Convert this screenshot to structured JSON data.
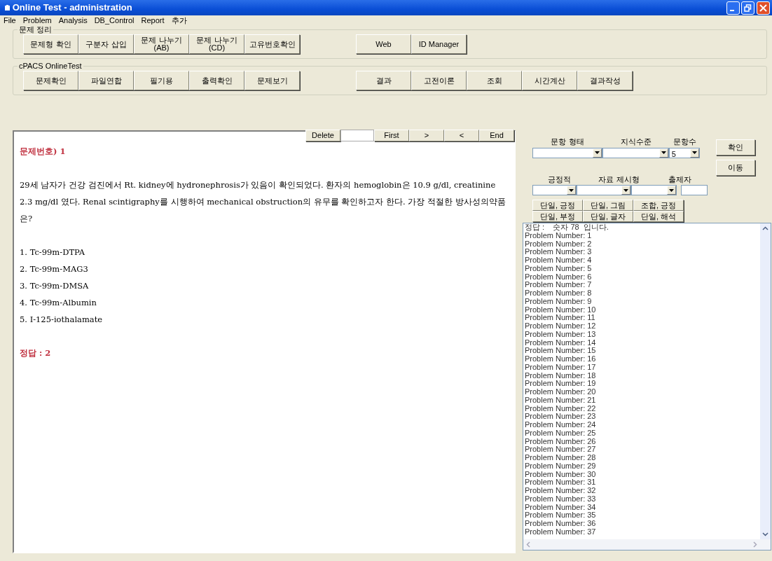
{
  "window": {
    "title": "Online Test - administration"
  },
  "menu": [
    "File",
    "Problem",
    "Analysis",
    "DB_Control",
    "Report",
    "추가"
  ],
  "groups": [
    {
      "label": "문제 정리",
      "left_buttons": [
        {
          "label": "문제형 확인"
        },
        {
          "label": "구분자 삽입"
        },
        {
          "label": "문제 나누기",
          "sublabel": "(AB)"
        },
        {
          "label": "문제 나누기",
          "sublabel": "(CD)"
        },
        {
          "label": "고유번호확인"
        }
      ],
      "right_buttons": [
        {
          "label": "Web"
        },
        {
          "label": "ID Manager"
        }
      ]
    },
    {
      "label": "cPACS OnlineTest",
      "left_buttons": [
        {
          "label": "문제확인"
        },
        {
          "label": "파일연합"
        },
        {
          "label": "필기용"
        },
        {
          "label": "출력확인"
        },
        {
          "label": "문제보기"
        }
      ],
      "right_buttons": [
        {
          "label": "결과"
        },
        {
          "label": "고전이론"
        },
        {
          "label": "조회"
        },
        {
          "label": "시간계산"
        },
        {
          "label": "결과작성"
        }
      ]
    }
  ],
  "navigator": [
    {
      "kind": "button",
      "label": "Delete"
    },
    {
      "kind": "field"
    },
    {
      "kind": "button",
      "label": "First"
    },
    {
      "kind": "button",
      "label": ">"
    },
    {
      "kind": "button",
      "label": "<"
    },
    {
      "kind": "button",
      "label": "End"
    }
  ],
  "problem": {
    "number": "문제번호) 1",
    "question": "29세 남자가 건강 검진에서 Rt. kidney에 hydronephrosis가 있음이 확인되었다. 환자의 hemoglobin은 10.9 g/dl, creatinine 2.3 mg/dl 였다. Renal scintigraphy를 시행하여 mechanical obstruction의 유무를 확인하고자 한다. 가장 적절한 방사성의약품은?",
    "options": [
      "1. Tc-99m-DTPA",
      "2. Tc-99m-MAG3",
      "3. Tc-99m-DMSA",
      "4. Tc-99m-Albumin",
      "5. I-125-iothalamate"
    ],
    "answer": "정답 : 2"
  },
  "filters_row_1": [
    {
      "label": "문항 형태"
    },
    {
      "label": "지식수준"
    },
    {
      "label": "문항수",
      "value": "5"
    }
  ],
  "filters_row_2": [
    {
      "label": "긍정적"
    },
    {
      "label": "자료 제시형"
    },
    {
      "label": "출제자"
    }
  ],
  "side_buttons": [
    "확인",
    "이동"
  ],
  "category_buttons": [
    "단일, 긍정",
    "단일, 그림",
    "조합, 긍정",
    "단일, 부정",
    "단일, 글자",
    "단일, 해석"
  ],
  "log": [
    "정답 :    숫자 78  입니다.",
    "Problem Number: 1",
    "Problem Number: 2",
    "Problem Number: 3",
    "Problem Number: 4",
    "Problem Number: 5",
    "Problem Number: 6",
    "Problem Number: 7",
    "Problem Number: 8",
    "Problem Number: 9",
    "Problem Number: 10",
    "Problem Number: 11",
    "Problem Number: 12",
    "Problem Number: 13",
    "Problem Number: 14",
    "Problem Number: 15",
    "Problem Number: 16",
    "Problem Number: 17",
    "Problem Number: 18",
    "Problem Number: 19",
    "Problem Number: 20",
    "Problem Number: 21",
    "Problem Number: 22",
    "Problem Number: 23",
    "Problem Number: 24",
    "Problem Number: 25",
    "Problem Number: 26",
    "Problem Number: 27",
    "Problem Number: 28",
    "Problem Number: 29",
    "Problem Number: 30",
    "Problem Number: 31",
    "Problem Number: 32",
    "Problem Number: 33",
    "Problem Number: 34",
    "Problem Number: 35",
    "Problem Number: 36",
    "Problem Number: 37"
  ]
}
